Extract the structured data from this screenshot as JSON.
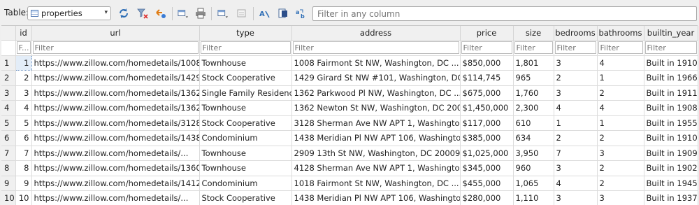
{
  "toolbar": {
    "table_label": "Table:",
    "selected_table": "properties",
    "filter_placeholder": "Filter in any column"
  },
  "grid": {
    "columns": [
      "id",
      "url",
      "type",
      "address",
      "price",
      "size",
      "bedrooms",
      "bathrooms",
      "builtin_year"
    ],
    "filter_placeholder": "Filter",
    "id_filter_placeholder": "F...",
    "rows": [
      {
        "rownum": "1",
        "id": "1",
        "url": "https://www.zillow.com/homedetails/1008-...",
        "type": "Townhouse",
        "address": "1008 Fairmont St NW, Washington, DC ...",
        "price": "$850,000",
        "size": "1,801",
        "bedrooms": "3",
        "bathrooms": "4",
        "builtin_year": "Built in 1910"
      },
      {
        "rownum": "2",
        "id": "2",
        "url": "https://www.zillow.com/homedetails/1429-...",
        "type": "Stock Cooperative",
        "address": "1429 Girard St NW #101, Washington, DC ...",
        "price": "$114,745",
        "size": "965",
        "bedrooms": "2",
        "bathrooms": "1",
        "builtin_year": "Built in 1966"
      },
      {
        "rownum": "3",
        "id": "3",
        "url": "https://www.zillow.com/homedetails/1362-...",
        "type": "Single Family Residence",
        "address": "1362 Parkwood Pl NW, Washington, DC ...",
        "price": "$675,000",
        "size": "1,760",
        "bedrooms": "3",
        "bathrooms": "2",
        "builtin_year": "Built in 1911"
      },
      {
        "rownum": "4",
        "id": "4",
        "url": "https://www.zillow.com/homedetails/1362-...",
        "type": "Townhouse",
        "address": "1362 Newton St NW, Washington, DC 20010",
        "price": "$1,450,000",
        "size": "2,300",
        "bedrooms": "4",
        "bathrooms": "4",
        "builtin_year": "Built in 1908"
      },
      {
        "rownum": "5",
        "id": "5",
        "url": "https://www.zillow.com/homedetails/3128-...",
        "type": "Stock Cooperative",
        "address": "3128 Sherman Ave NW APT 1, Washington,...",
        "price": "$117,000",
        "size": "610",
        "bedrooms": "1",
        "bathrooms": "1",
        "builtin_year": "Built in 1955"
      },
      {
        "rownum": "6",
        "id": "6",
        "url": "https://www.zillow.com/homedetails/1438-...",
        "type": "Condominium",
        "address": "1438 Meridian Pl NW APT 106, Washington...",
        "price": "$385,000",
        "size": "634",
        "bedrooms": "2",
        "bathrooms": "2",
        "builtin_year": "Built in 1910"
      },
      {
        "rownum": "7",
        "id": "7",
        "url": "https://www.zillow.com/homedetails/...",
        "type": "Townhouse",
        "address": "2909 13th St NW, Washington, DC 20009",
        "price": "$1,025,000",
        "size": "3,950",
        "bedrooms": "7",
        "bathrooms": "3",
        "builtin_year": "Built in 1909"
      },
      {
        "rownum": "8",
        "id": "8",
        "url": "https://www.zillow.com/homedetails/1360-...",
        "type": "Townhouse",
        "address": "4128 Sherman Ave NW APT 1, Washington,...",
        "price": "$345,000",
        "size": "960",
        "bedrooms": "3",
        "bathrooms": "2",
        "builtin_year": "Built in 1902"
      },
      {
        "rownum": "9",
        "id": "9",
        "url": "https://www.zillow.com/homedetails/1412-...",
        "type": "Condominium",
        "address": "1018 Fairmont St NW, Washington, DC ...",
        "price": "$455,000",
        "size": "1,065",
        "bedrooms": "4",
        "bathrooms": "2",
        "builtin_year": "Built in 1945"
      },
      {
        "rownum": "10",
        "id": "10",
        "url": "https://www.zillow.com/homedetails/...",
        "type": "Stock Cooperative",
        "address": "1438 Meridian Pl NW APT 106, Washington...",
        "price": "$280,000",
        "size": "1,110",
        "bedrooms": "3",
        "bathrooms": "3",
        "builtin_year": "Built in 1937"
      }
    ]
  }
}
